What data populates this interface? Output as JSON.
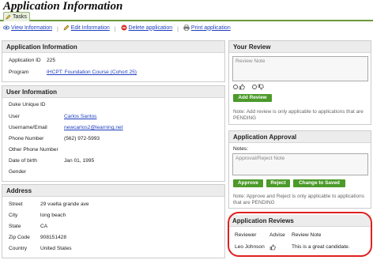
{
  "page": {
    "title": "Application Information"
  },
  "tabs": [
    {
      "label": "Tasks"
    }
  ],
  "actions": {
    "view": "View Information",
    "edit": "Edit Information",
    "delete": "Delete application",
    "print": "Print application",
    "separator": "|"
  },
  "application_info": {
    "heading": "Application Information",
    "id_label": "Application ID",
    "id_value": "225",
    "program_label": "Program",
    "program_value": "IHCPT: Foundation Course (Cohort 25)"
  },
  "user_info": {
    "heading": "User Information",
    "duke_label": "Duke Unique ID",
    "user_label": "User",
    "user_value": "Carlos Santos",
    "email_label": "Username/Email",
    "email_value": "newcarlos2@learning.net",
    "phone_label": "Phone Number",
    "phone_value": "(562) 972-5993",
    "other_phone_label": "Other Phone Number",
    "dob_label": "Date of birth",
    "dob_value": "Jan 01, 1995",
    "gender_label": "Gender"
  },
  "address": {
    "heading": "Address",
    "street_label": "Street",
    "street_value": "29 vuelta grande ave",
    "city_label": "City",
    "city_value": "long beach",
    "state_label": "State",
    "state_value": "CA",
    "zip_label": "Zip Code",
    "zip_value": "908151428",
    "country_label": "Country",
    "country_value": "United States"
  },
  "your_review": {
    "heading": "Your Review",
    "placeholder": "Review Note",
    "add_button": "Add Review",
    "note": "Note: Add review is only applicable to applications that are PENDING"
  },
  "approval": {
    "heading": "Application Approval",
    "notes_label": "Notes:",
    "placeholder": "Approval/Reject Note",
    "approve_button": "Approve",
    "reject_button": "Reject",
    "change_button": "Change to Saved",
    "note": "Note: Approve and Reject is only applicable to applications that are PENDING"
  },
  "reviews": {
    "heading": "Application Reviews",
    "col_reviewer": "Reviewer",
    "col_advise": "Advise",
    "col_note": "Review Note",
    "rows": [
      {
        "reviewer": "Leo Johnson",
        "note": "This is a great candidate."
      }
    ]
  },
  "colors": {
    "accent_green": "#4c9a2a",
    "link_blue": "#1f3fbf",
    "highlight_red": "#e02020"
  }
}
